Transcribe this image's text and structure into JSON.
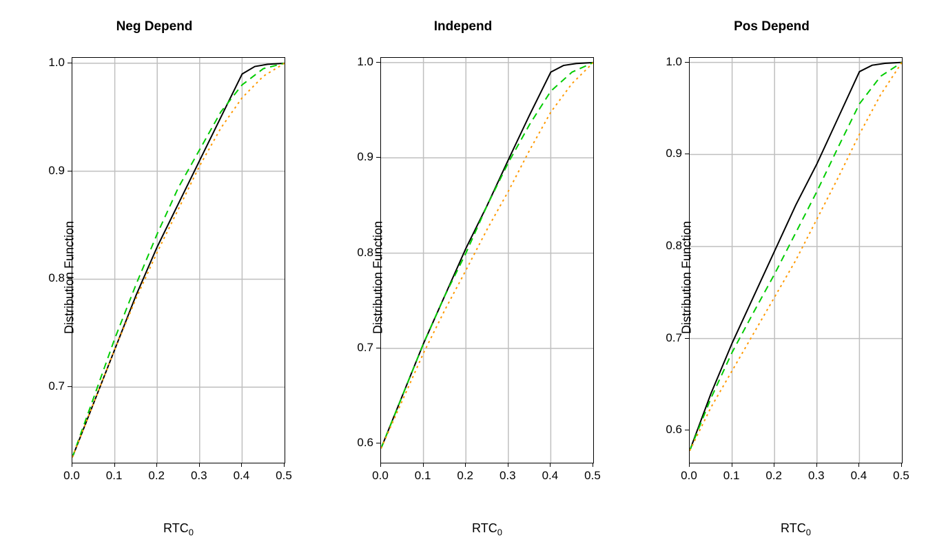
{
  "chart_data": [
    {
      "type": "line",
      "title": "Neg Depend",
      "xlabel": "RTC0",
      "ylabel": "Distribution Function",
      "xlim": [
        0.0,
        0.5
      ],
      "ylim": [
        0.63,
        1.005
      ],
      "xticks": [
        0.0,
        0.1,
        0.2,
        0.3,
        0.4,
        0.5
      ],
      "yticks": [
        0.7,
        0.8,
        0.9,
        1.0
      ],
      "grid_x": [
        0.1,
        0.2,
        0.3,
        0.4
      ],
      "grid_y": [
        0.7,
        0.8,
        0.9,
        1.0
      ],
      "series": [
        {
          "name": "solid",
          "style": "solid",
          "color": "#000000",
          "x": [
            0.0,
            0.05,
            0.1,
            0.15,
            0.2,
            0.25,
            0.3,
            0.35,
            0.4,
            0.43,
            0.46,
            0.5
          ],
          "y": [
            0.635,
            0.685,
            0.735,
            0.785,
            0.83,
            0.87,
            0.91,
            0.95,
            0.99,
            0.997,
            0.999,
            1.0
          ]
        },
        {
          "name": "dash",
          "style": "dash",
          "color": "#00cc00",
          "x": [
            0.0,
            0.05,
            0.1,
            0.15,
            0.2,
            0.25,
            0.3,
            0.35,
            0.4,
            0.45,
            0.5
          ],
          "y": [
            0.635,
            0.69,
            0.745,
            0.795,
            0.842,
            0.885,
            0.92,
            0.955,
            0.98,
            0.995,
            1.0
          ]
        },
        {
          "name": "dot",
          "style": "dot",
          "color": "#ff9900",
          "x": [
            0.0,
            0.05,
            0.1,
            0.15,
            0.2,
            0.25,
            0.3,
            0.35,
            0.4,
            0.45,
            0.5
          ],
          "y": [
            0.635,
            0.685,
            0.735,
            0.782,
            0.825,
            0.865,
            0.905,
            0.94,
            0.968,
            0.988,
            1.0
          ]
        }
      ]
    },
    {
      "type": "line",
      "title": "Independ",
      "xlabel": "RTC0",
      "ylabel": "Distribution Function",
      "xlim": [
        0.0,
        0.5
      ],
      "ylim": [
        0.58,
        1.005
      ],
      "xticks": [
        0.0,
        0.1,
        0.2,
        0.3,
        0.4,
        0.5
      ],
      "yticks": [
        0.6,
        0.7,
        0.8,
        0.9,
        1.0
      ],
      "grid_x": [
        0.1,
        0.2,
        0.3,
        0.4
      ],
      "grid_y": [
        0.7,
        0.8,
        0.9,
        1.0
      ],
      "series": [
        {
          "name": "solid",
          "style": "solid",
          "color": "#000000",
          "x": [
            0.0,
            0.05,
            0.1,
            0.15,
            0.2,
            0.25,
            0.3,
            0.35,
            0.4,
            0.43,
            0.46,
            0.5
          ],
          "y": [
            0.595,
            0.65,
            0.705,
            0.755,
            0.805,
            0.85,
            0.898,
            0.945,
            0.99,
            0.997,
            0.999,
            1.0
          ]
        },
        {
          "name": "dash",
          "style": "dash",
          "color": "#00cc00",
          "x": [
            0.0,
            0.05,
            0.1,
            0.15,
            0.2,
            0.25,
            0.3,
            0.35,
            0.4,
            0.45,
            0.5
          ],
          "y": [
            0.595,
            0.65,
            0.705,
            0.755,
            0.8,
            0.85,
            0.895,
            0.935,
            0.97,
            0.99,
            1.0
          ]
        },
        {
          "name": "dot",
          "style": "dot",
          "color": "#ff9900",
          "x": [
            0.0,
            0.05,
            0.1,
            0.15,
            0.2,
            0.25,
            0.3,
            0.35,
            0.4,
            0.45,
            0.5
          ],
          "y": [
            0.595,
            0.645,
            0.695,
            0.74,
            0.782,
            0.825,
            0.865,
            0.908,
            0.948,
            0.978,
            1.0
          ]
        }
      ]
    },
    {
      "type": "line",
      "title": "Pos Depend",
      "xlabel": "RTC0",
      "ylabel": "Distribution Function",
      "xlim": [
        0.0,
        0.5
      ],
      "ylim": [
        0.565,
        1.005
      ],
      "xticks": [
        0.0,
        0.1,
        0.2,
        0.3,
        0.4,
        0.5
      ],
      "yticks": [
        0.6,
        0.7,
        0.8,
        0.9,
        1.0
      ],
      "grid_x": [
        0.1,
        0.2,
        0.3,
        0.4
      ],
      "grid_y": [
        0.7,
        0.8,
        0.9,
        1.0
      ],
      "series": [
        {
          "name": "solid",
          "style": "solid",
          "color": "#000000",
          "x": [
            0.0,
            0.05,
            0.1,
            0.15,
            0.2,
            0.25,
            0.3,
            0.35,
            0.4,
            0.43,
            0.46,
            0.5
          ],
          "y": [
            0.578,
            0.64,
            0.695,
            0.745,
            0.795,
            0.845,
            0.89,
            0.94,
            0.99,
            0.997,
            0.999,
            1.0
          ]
        },
        {
          "name": "dash",
          "style": "dash",
          "color": "#00cc00",
          "x": [
            0.0,
            0.05,
            0.1,
            0.15,
            0.2,
            0.25,
            0.3,
            0.35,
            0.4,
            0.45,
            0.5
          ],
          "y": [
            0.578,
            0.635,
            0.685,
            0.728,
            0.77,
            0.815,
            0.86,
            0.908,
            0.955,
            0.985,
            1.0
          ]
        },
        {
          "name": "dot",
          "style": "dot",
          "color": "#ff9900",
          "x": [
            0.0,
            0.05,
            0.1,
            0.15,
            0.2,
            0.25,
            0.3,
            0.35,
            0.4,
            0.45,
            0.5
          ],
          "y": [
            0.578,
            0.625,
            0.665,
            0.705,
            0.745,
            0.785,
            0.83,
            0.875,
            0.922,
            0.965,
            1.0
          ]
        }
      ]
    }
  ]
}
